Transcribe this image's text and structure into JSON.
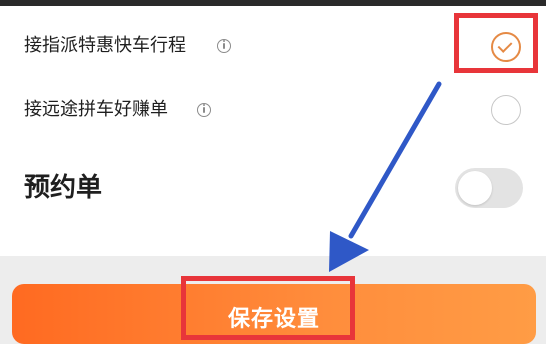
{
  "settings": {
    "items": [
      {
        "label": "接指派特惠快车行程",
        "state": "checked",
        "has_info_icon": true
      },
      {
        "label": "接远途拼车好赚单",
        "state": "unchecked",
        "has_info_icon": true
      },
      {
        "label": "预约单",
        "state": "toggle-off",
        "has_info_icon": false
      }
    ]
  },
  "footer": {
    "save_label": "保存设置"
  },
  "colors": {
    "accent": "#ff7a2f",
    "check_orange": "#e58a45",
    "annotation_red": "#e8353a",
    "annotation_arrow": "#2f58c7"
  }
}
